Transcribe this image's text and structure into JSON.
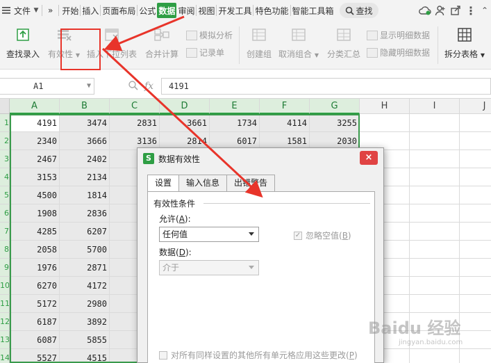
{
  "menubar": {
    "file_label": "文件",
    "overflow_label": "»",
    "tabs": [
      {
        "label": "开始"
      },
      {
        "label": "插入"
      },
      {
        "label": "页面布局"
      },
      {
        "label": "公式"
      },
      {
        "label": "数据"
      },
      {
        "label": "审阅"
      },
      {
        "label": "视图"
      },
      {
        "label": "开发工具"
      },
      {
        "label": "特色功能"
      },
      {
        "label": "智能工具箱"
      }
    ],
    "active_tab": "数据",
    "search_label": "查找"
  },
  "ribbon": {
    "find_entry": "查找录入",
    "validity": "有效性",
    "insert_dropdown": "插入下拉列表",
    "merge_calc": "合并计算",
    "simulate": "模拟分析",
    "record": "记录单",
    "create_group": "创建组",
    "ungroup": "取消组合",
    "subtotal": "分类汇总",
    "show_detail": "显示明细数据",
    "hide_detail": "隐藏明细数据",
    "split_table": "拆分表格"
  },
  "formula_bar": {
    "name_box": "A1",
    "fx_label": "fx",
    "value": "4191"
  },
  "grid": {
    "columns": [
      "A",
      "B",
      "C",
      "D",
      "E",
      "F",
      "G",
      "H",
      "I",
      "J"
    ],
    "row_labels": [
      "1",
      "2",
      "3",
      "4",
      "5",
      "6",
      "7",
      "8",
      "9",
      "10",
      "11",
      "12",
      "13",
      "14"
    ],
    "rows": [
      [
        "4191",
        "3474",
        "2831",
        "3661",
        "1734",
        "4114",
        "3255"
      ],
      [
        "2340",
        "3666",
        "3136",
        "2814",
        "6017",
        "1581",
        "2030"
      ],
      [
        "2467",
        "2402",
        "",
        "",
        "",
        "",
        ""
      ],
      [
        "3153",
        "2134",
        "",
        "",
        "",
        "",
        ""
      ],
      [
        "4500",
        "1814",
        "",
        "",
        "",
        "",
        ""
      ],
      [
        "1908",
        "2836",
        "",
        "",
        "",
        "",
        ""
      ],
      [
        "4285",
        "6207",
        "",
        "",
        "",
        "",
        ""
      ],
      [
        "2058",
        "5700",
        "",
        "",
        "",
        "",
        ""
      ],
      [
        "1976",
        "2871",
        "",
        "",
        "",
        "",
        ""
      ],
      [
        "6270",
        "4172",
        "",
        "",
        "",
        "",
        ""
      ],
      [
        "5172",
        "2980",
        "",
        "",
        "",
        "",
        ""
      ],
      [
        "6187",
        "3892",
        "",
        "",
        "",
        "",
        ""
      ],
      [
        "6087",
        "5855",
        "",
        "",
        "",
        "",
        ""
      ],
      [
        "5527",
        "4515",
        "",
        "",
        "",
        "",
        ""
      ]
    ]
  },
  "dialog": {
    "title": "数据有效性",
    "close_label": "×",
    "tabs": [
      {
        "label": "设置"
      },
      {
        "label": "输入信息"
      },
      {
        "label": "出错警告"
      }
    ],
    "group_title": "有效性条件",
    "allow_label": "允许(",
    "allow_key": "A",
    "allow_suffix": "):",
    "allow_value": "任何值",
    "ignore_blank_label": "忽略空值(",
    "ignore_blank_key": "B",
    "ignore_blank_suffix": ")",
    "ignore_blank_checked": true,
    "data_label": "数据(",
    "data_key": "D",
    "data_suffix": "):",
    "data_value": "介于",
    "apply_all_label": "对所有同样设置的其他所有单元格应用这些更改(",
    "apply_all_key": "P",
    "apply_all_suffix": ")"
  },
  "watermark": {
    "text": "Baidu 经验",
    "sub": "jingyan.baidu.com"
  },
  "colors": {
    "accent_green": "#2e9e44",
    "annotation_red": "#e8342a",
    "close_red": "#e04343"
  }
}
